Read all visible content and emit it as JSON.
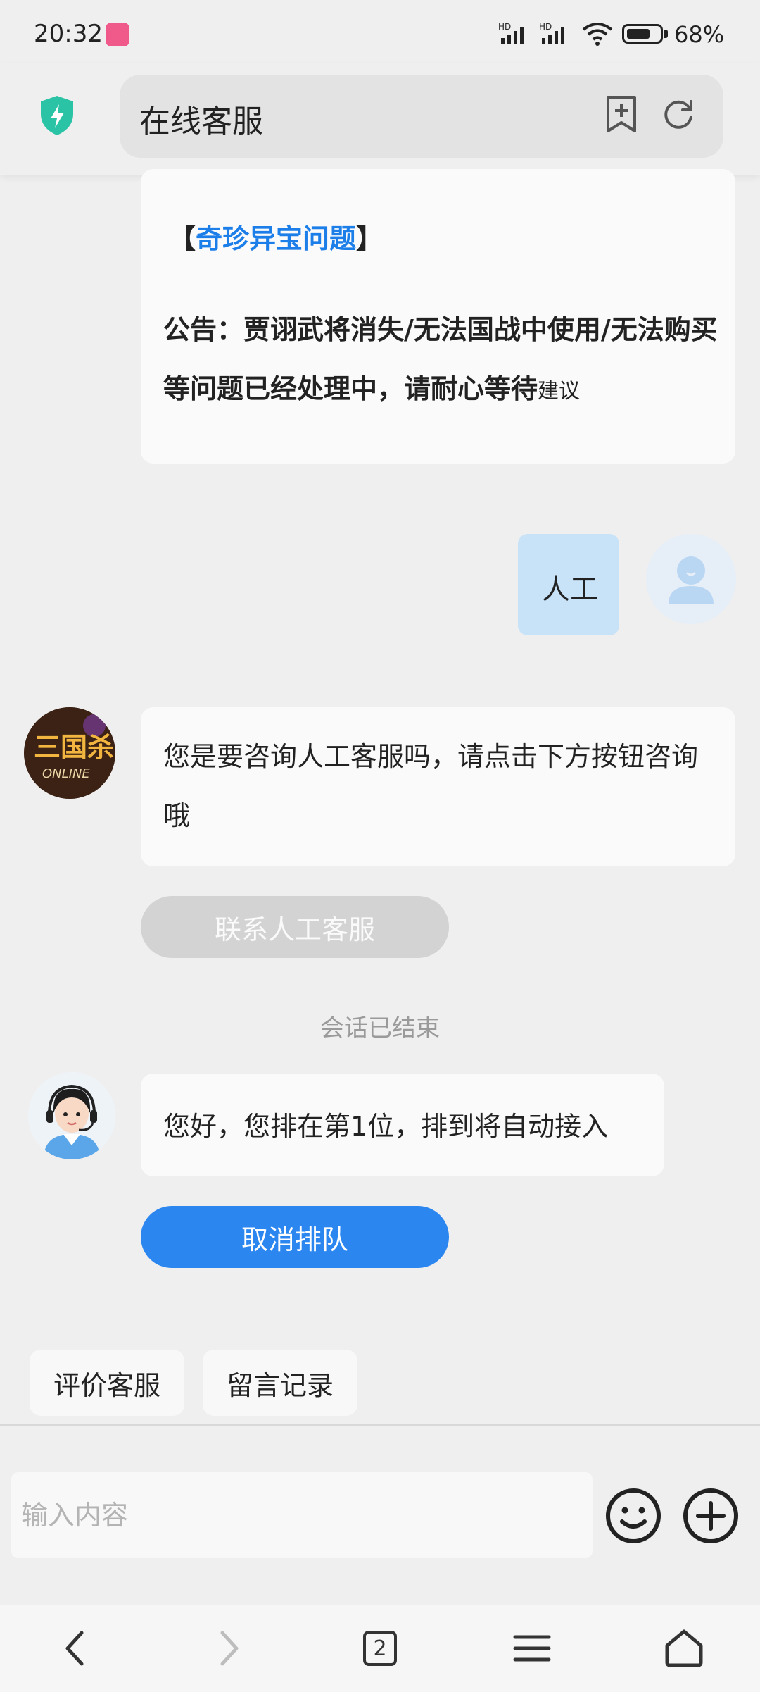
{
  "status_bar": {
    "time": "20:32",
    "network_1": "HD",
    "network_2": "HD",
    "battery": "68%"
  },
  "header": {
    "title": "在线客服"
  },
  "messages": {
    "faq": {
      "bracket_open": "【",
      "title": "奇珍异宝问题",
      "bracket_close": "】",
      "body": "公告：贾诩武将消失/无法国战中使用/无法购买等问题已经处理中，请耐心等待",
      "suffix": "建议"
    },
    "user": {
      "text": "人工"
    },
    "bot": {
      "text": "您是要咨询人工客服吗，请点击下方按钮咨询哦",
      "button": "联系人工客服"
    },
    "system": {
      "text": "会话已结束"
    },
    "agent": {
      "text": "您好，您排在第1位，排到将自动接入",
      "button": "取消排队"
    }
  },
  "quick_actions": {
    "rate": "评价客服",
    "records": "留言记录"
  },
  "input": {
    "placeholder": "输入内容"
  },
  "nav": {
    "tab_count": "2"
  },
  "colors": {
    "accent": "#2b86f0",
    "highlight": "#1c7ee8",
    "user_bubble": "#c8e2f8",
    "background": "#efefef"
  }
}
